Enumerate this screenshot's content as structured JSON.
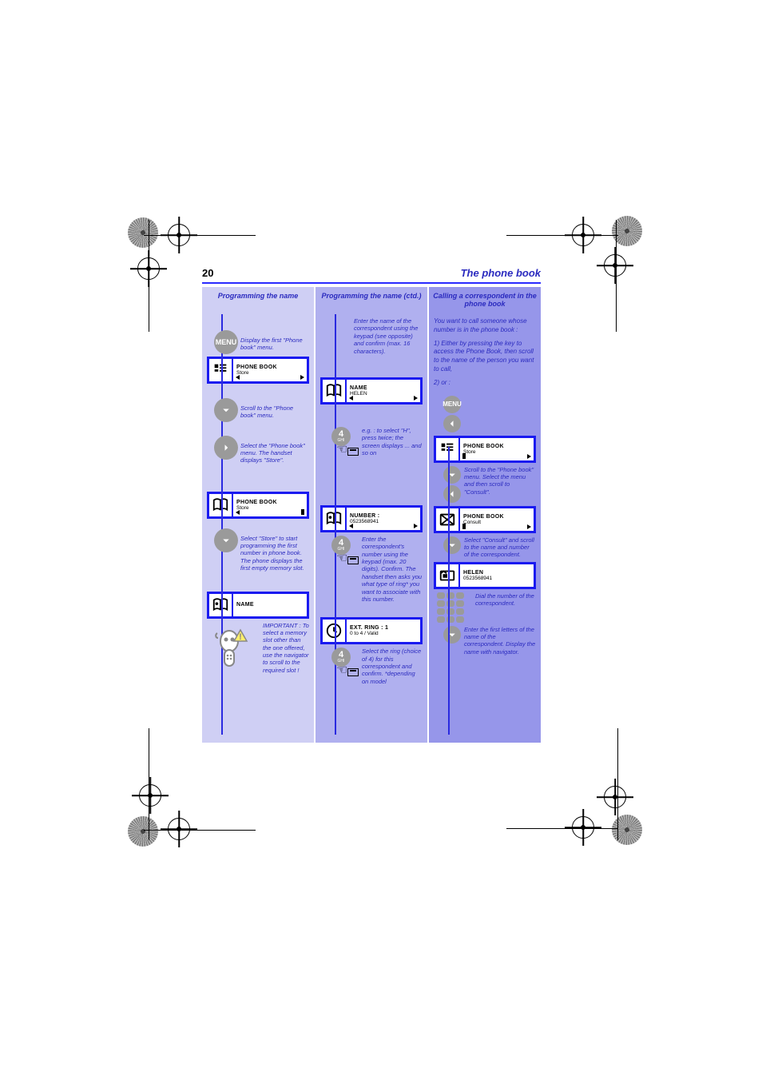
{
  "header": {
    "page_number": "20",
    "title": "The phone book"
  },
  "col1": {
    "heading": "Programming the name",
    "menu": "MENU",
    "cap_menu": "Display the first\n\"Phone book\" menu.",
    "screen1": {
      "line1": "PHONE BOOK",
      "line2": "Store"
    },
    "cap_down": "Scroll to the \"Phone\nbook\" menu.",
    "cap_right": "Select the \"Phone\nbook\" menu.\nThe handset displays\n\"Store\".",
    "screen2": {
      "line1": "PHONE BOOK",
      "line2": "Store"
    },
    "cap_down2": "Select \"Store\" to start programming the first number in phone book. The phone displays the first empty memory slot.",
    "screen3": {
      "line1": "NAME",
      "line2": ""
    },
    "robot_caption": "IMPORTANT :\nTo select a\nmemory slot other\nthan the one offered,\nuse the navigator\nto scroll to\nthe required slot !"
  },
  "col2": {
    "heading": "Programming the name (ctd.)",
    "caption_top": "Enter the name of the\ncorrespondent using\nthe keypad (see\nopposite) and confirm\n(max. 16 characters).",
    "screen1": {
      "line1": "NAME",
      "line2": "HELEN"
    },
    "key4": {
      "num": "4",
      "letters": "GHI"
    },
    "cap_key1": "e.g. : to select \"H\",\npress  twice; the\nscreen displays ... and\nso on",
    "screen2": {
      "line1": "NUMBER :",
      "line2": "0523568941"
    },
    "cap_num": "Enter the correspondent's number using the keypad (max. 20 digits). Confirm.\nThe handset then asks you what type of ring* you want to associate with this number.",
    "screen3": {
      "line1": "EXT. RING : 1",
      "line2": "0 to 4 / Valid"
    },
    "cap_ring": "Select the ring\n(choice of 4) for this\ncorrespondent and\nconfirm.\n*depending on model"
  },
  "col3": {
    "heading": "Calling a correspondent in the phone book",
    "intro_lines": [
      "You want to call someone whose number is in the phone book :",
      "1) Either by pressing the key to access the Phone Book, then scroll to the name of the person you want to call,",
      "2) or :"
    ],
    "menu": "MENU",
    "screen1": {
      "line1": "PHONE BOOK",
      "line2": "Store"
    },
    "cap_scroll": "Scroll to the \"Phone\nbook\" menu.\nSelect the menu and\nthen scroll to\n\"Consult\".",
    "screen2": {
      "line1": "PHONE BOOK",
      "line2": "Consult"
    },
    "cap_consult": "Select \"Consult\" and scroll to the name and number of the correspondent.",
    "screen3": {
      "line1": "HELEN",
      "line2": "0523568941"
    },
    "cap_dial": "Dial the number of\nthe correspondent.",
    "cap_enter": "Enter the first letters of the name of the correspondent. Display the name with navigator."
  }
}
